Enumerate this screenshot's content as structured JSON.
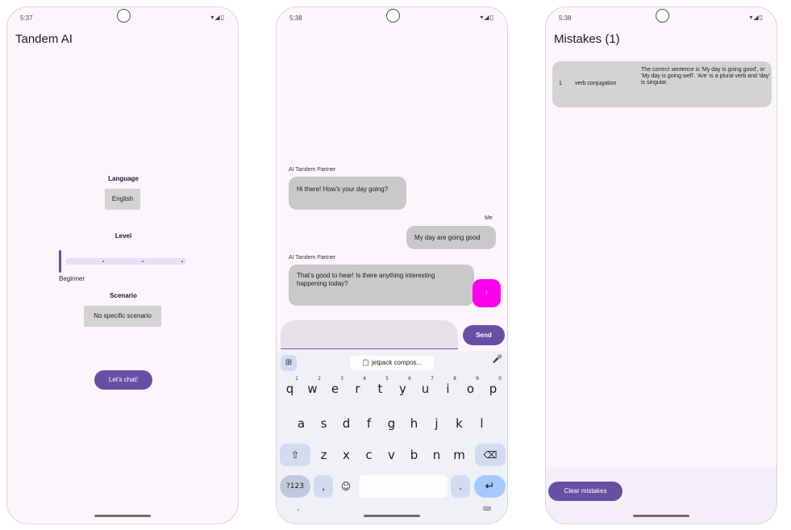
{
  "screen1": {
    "status_time": "5:37",
    "title": "Tandem AI",
    "language_label": "Language",
    "language_value": "English",
    "level_label": "Level",
    "level_value": "Beginner",
    "level_fraction": 0,
    "scenario_label": "Scenario",
    "scenario_value": "No specific scenario",
    "start_button": "Let's chat!"
  },
  "screen2": {
    "status_time": "5:38",
    "messages": [
      {
        "sender": "AI Tandem Partner",
        "text": "Hi there! How's your day going?"
      },
      {
        "sender": "Me",
        "text": "My day are going good"
      },
      {
        "sender": "AI Tandem Partner",
        "text": "That's good to hear!  Is there anything interesting happening today?"
      }
    ],
    "fab_label": "↑",
    "input_placeholder": "",
    "send_label": "Send",
    "clipboard_text": "jetpack compos...",
    "keyboard": {
      "row1": [
        "q",
        "w",
        "e",
        "r",
        "t",
        "y",
        "u",
        "i",
        "o",
        "p"
      ],
      "row1_hints": [
        "1",
        "2",
        "3",
        "4",
        "5",
        "6",
        "7",
        "8",
        "9",
        "0"
      ],
      "row2": [
        "a",
        "s",
        "d",
        "f",
        "g",
        "h",
        "j",
        "k",
        "l"
      ],
      "row3": [
        "z",
        "x",
        "c",
        "v",
        "b",
        "n",
        "m"
      ],
      "symbols_key": "?123",
      "comma_key": ",",
      "period_key": "."
    }
  },
  "screen3": {
    "status_time": "5:38",
    "title": "Mistakes (1)",
    "mistakes": [
      {
        "index": "1",
        "category": "verb conjugation",
        "explanation": "The correct sentence is 'My day is going good', or 'My day is going well'. 'Are' is a plural verb and 'day' is singular."
      }
    ],
    "clear_button": "Clear mistakes"
  },
  "colors": {
    "primary": "#6750a4",
    "background": "#fdf5fc",
    "bubble": "#c9c9c9",
    "fab": "#ff00ee"
  }
}
